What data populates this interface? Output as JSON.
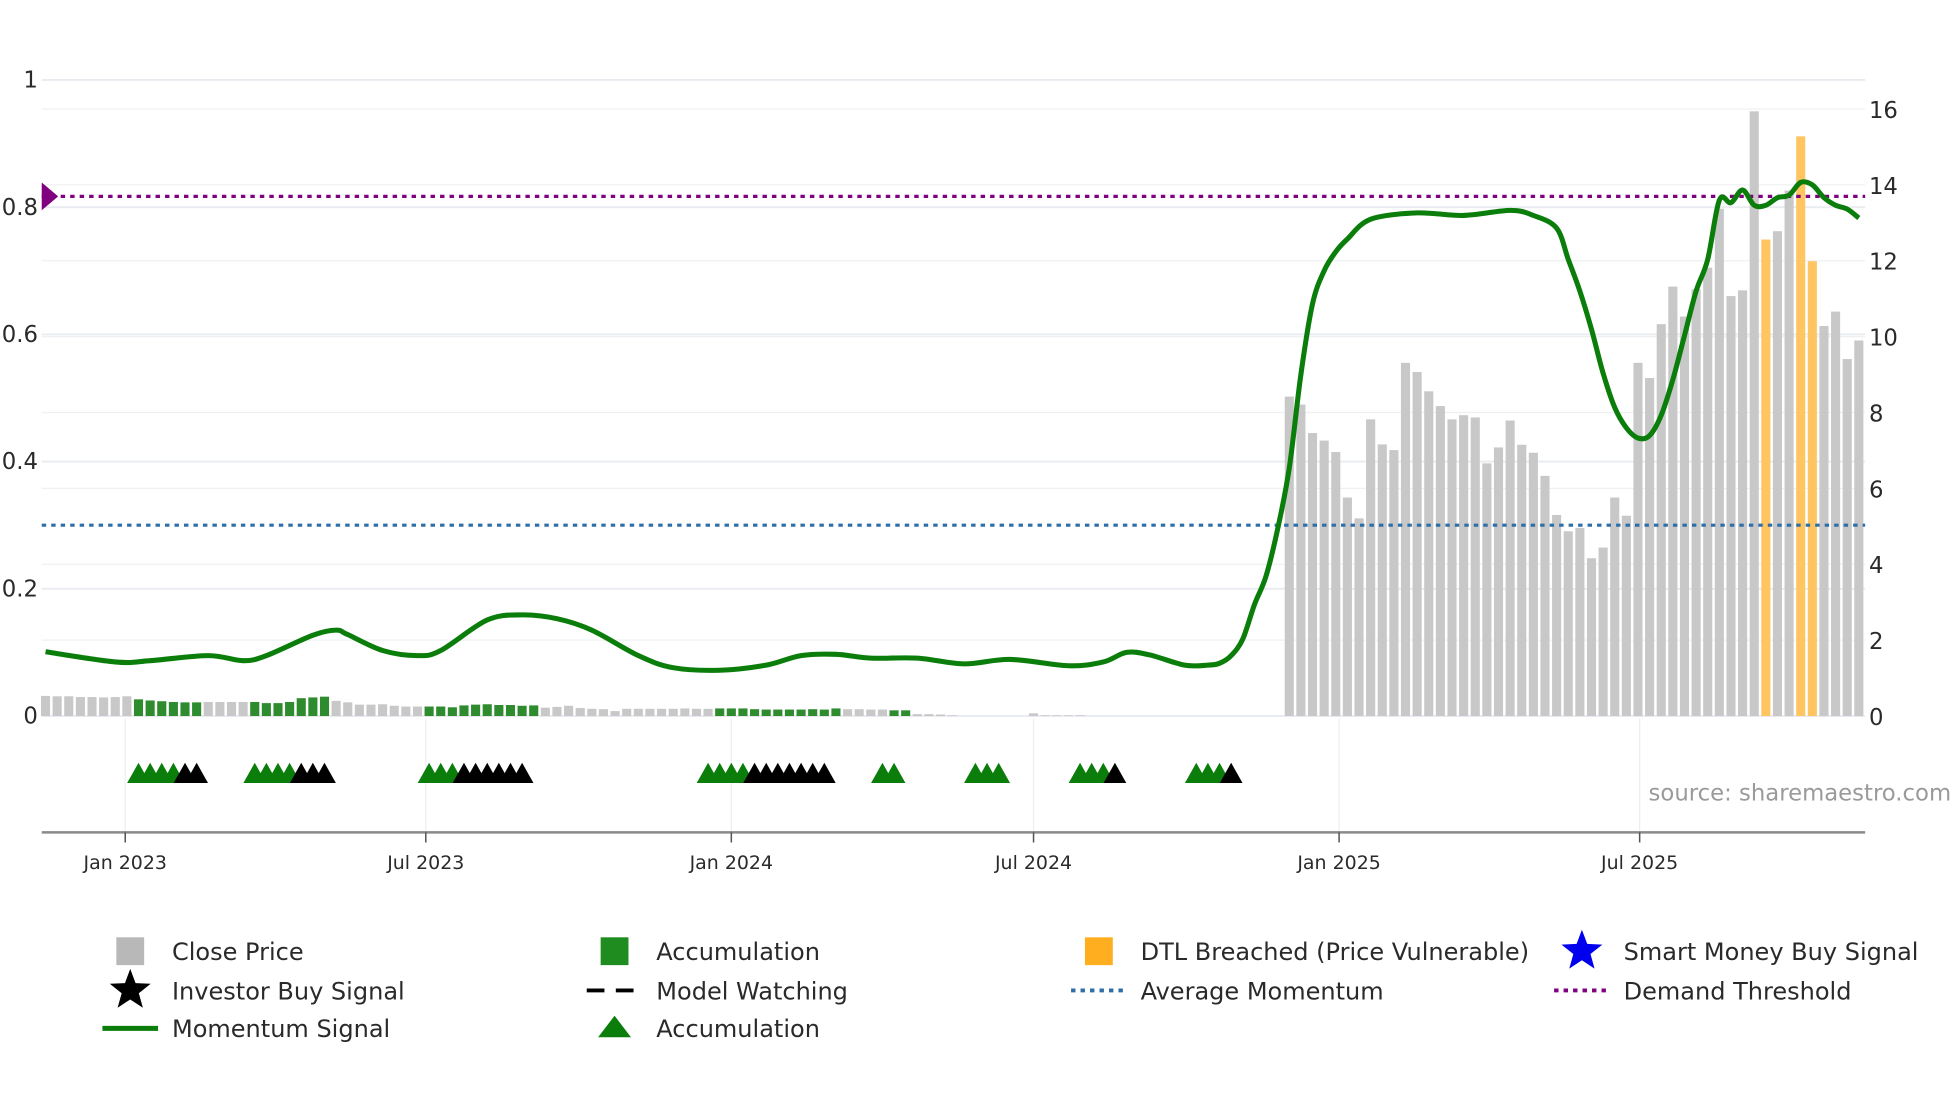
{
  "chart_data": {
    "type": "bar+line",
    "source_note": "source: sharemaestro.com",
    "left_axis": {
      "range": [
        0,
        1
      ],
      "ticks": [
        "0",
        "0.2",
        "0.4",
        "0.6",
        "0.8",
        "1"
      ]
    },
    "right_axis": {
      "range": [
        0,
        16
      ],
      "ticks": [
        "0",
        "2",
        "4",
        "6",
        "8",
        "10",
        "12",
        "14",
        "16"
      ]
    },
    "x_axis": {
      "range": [
        "2022-11-14",
        "2025-11-10"
      ],
      "ticks": [
        {
          "date": "2023-01-01",
          "label": "Jan 2023"
        },
        {
          "date": "2023-07-01",
          "label": "Jul 2023"
        },
        {
          "date": "2024-01-01",
          "label": "Jan 2024"
        },
        {
          "date": "2024-07-01",
          "label": "Jul 2024"
        },
        {
          "date": "2025-01-01",
          "label": "Jan 2025"
        },
        {
          "date": "2025-07-01",
          "label": "Jul 2025"
        }
      ]
    },
    "weeks": [
      "2022-11-14",
      "2022-11-21",
      "2022-11-28",
      "2022-12-05",
      "2022-12-12",
      "2022-12-19",
      "2022-12-26",
      "2023-01-02",
      "2023-01-09",
      "2023-01-16",
      "2023-01-23",
      "2023-01-30",
      "2023-02-06",
      "2023-02-13",
      "2023-02-20",
      "2023-02-27",
      "2023-03-06",
      "2023-03-13",
      "2023-03-20",
      "2023-03-27",
      "2023-04-03",
      "2023-04-10",
      "2023-04-17",
      "2023-04-24",
      "2023-05-01",
      "2023-05-08",
      "2023-05-15",
      "2023-05-22",
      "2023-05-29",
      "2023-06-05",
      "2023-06-12",
      "2023-06-19",
      "2023-06-26",
      "2023-07-03",
      "2023-07-10",
      "2023-07-17",
      "2023-07-24",
      "2023-07-31",
      "2023-08-07",
      "2023-08-14",
      "2023-08-21",
      "2023-08-28",
      "2023-09-04",
      "2023-09-11",
      "2023-09-18",
      "2023-09-25",
      "2023-10-02",
      "2023-10-09",
      "2023-10-16",
      "2023-10-23",
      "2023-10-30",
      "2023-11-06",
      "2023-11-13",
      "2023-11-20",
      "2023-11-27",
      "2023-12-04",
      "2023-12-11",
      "2023-12-18",
      "2023-12-25",
      "2024-01-01",
      "2024-01-08",
      "2024-01-15",
      "2024-01-22",
      "2024-01-29",
      "2024-02-05",
      "2024-02-12",
      "2024-02-19",
      "2024-02-26",
      "2024-03-04",
      "2024-03-11",
      "2024-03-18",
      "2024-03-25",
      "2024-04-01",
      "2024-04-08",
      "2024-04-15",
      "2024-04-22",
      "2024-04-29",
      "2024-05-06",
      "2024-05-13",
      "2024-05-20",
      "2024-05-27",
      "2024-06-03",
      "2024-06-10",
      "2024-06-17",
      "2024-06-24",
      "2024-07-01",
      "2024-07-08",
      "2024-07-15",
      "2024-07-22",
      "2024-07-29",
      "2024-08-05",
      "2024-08-12",
      "2024-08-19",
      "2024-08-26",
      "2024-09-02",
      "2024-09-09",
      "2024-09-16",
      "2024-09-23",
      "2024-09-30",
      "2024-10-07",
      "2024-10-14",
      "2024-10-21",
      "2024-10-28",
      "2024-11-04",
      "2024-11-11",
      "2024-11-18",
      "2024-11-25",
      "2024-12-02",
      "2024-12-09",
      "2024-12-16",
      "2024-12-23",
      "2024-12-30",
      "2025-01-06",
      "2025-01-13",
      "2025-01-20",
      "2025-01-27",
      "2025-02-03",
      "2025-02-10",
      "2025-02-17",
      "2025-02-24",
      "2025-03-03",
      "2025-03-10",
      "2025-03-17",
      "2025-03-24",
      "2025-03-31",
      "2025-04-07",
      "2025-04-14",
      "2025-04-21",
      "2025-04-28",
      "2025-05-05",
      "2025-05-12",
      "2025-05-19",
      "2025-05-26",
      "2025-06-02",
      "2025-06-09",
      "2025-06-16",
      "2025-06-23",
      "2025-06-30",
      "2025-07-07",
      "2025-07-14",
      "2025-07-21",
      "2025-07-28",
      "2025-08-04",
      "2025-08-11",
      "2025-08-18",
      "2025-08-25",
      "2025-09-01",
      "2025-09-08",
      "2025-09-15",
      "2025-09-22",
      "2025-09-29",
      "2025-10-06",
      "2025-10-13",
      "2025-10-20",
      "2025-10-27",
      "2025-11-03",
      "2025-11-10"
    ],
    "close_price": [
      0.53,
      0.52,
      0.52,
      0.5,
      0.5,
      0.49,
      0.5,
      0.52,
      0.44,
      0.41,
      0.39,
      0.37,
      0.36,
      0.36,
      0.37,
      0.37,
      0.37,
      0.37,
      0.37,
      0.34,
      0.34,
      0.37,
      0.47,
      0.49,
      0.51,
      0.4,
      0.36,
      0.3,
      0.3,
      0.31,
      0.27,
      0.25,
      0.25,
      0.25,
      0.25,
      0.23,
      0.28,
      0.3,
      0.31,
      0.29,
      0.29,
      0.27,
      0.28,
      0.22,
      0.24,
      0.27,
      0.21,
      0.19,
      0.18,
      0.13,
      0.19,
      0.19,
      0.19,
      0.19,
      0.19,
      0.2,
      0.19,
      0.19,
      0.2,
      0.2,
      0.2,
      0.18,
      0.17,
      0.17,
      0.17,
      0.17,
      0.18,
      0.17,
      0.2,
      0.18,
      0.18,
      0.17,
      0.17,
      0.15,
      0.15,
      0.05,
      0.05,
      0.04,
      0.02,
      0,
      0,
      0,
      0,
      0,
      0,
      0.07,
      0.02,
      0.02,
      0.02,
      0.02,
      0,
      0,
      0,
      0,
      0,
      0,
      0,
      0,
      0,
      0,
      0,
      0,
      0,
      0,
      0,
      0,
      0,
      8.42,
      8.21,
      7.46,
      7.26,
      6.96,
      5.76,
      5.21,
      7.82,
      7.16,
      7.01,
      9.31,
      9.07,
      8.56,
      8.17,
      7.82,
      7.93,
      7.87,
      6.66,
      7.08,
      7.79,
      7.15,
      6.94,
      6.33,
      5.3,
      4.87,
      4.96,
      4.16,
      4.44,
      5.76,
      5.28,
      9.31,
      8.91,
      10.33,
      11.32,
      10.53,
      11.25,
      11.82,
      13.37,
      11.07,
      11.22,
      15.94,
      12.56,
      12.78,
      13.85,
      15.28,
      11.99,
      10.28,
      10.66,
      9.41,
      9.9
    ],
    "accumulation_bar_ranges": [
      [
        "2023-01-09",
        "2023-02-13"
      ],
      [
        "2023-03-20",
        "2023-05-01"
      ],
      [
        "2023-07-03",
        "2023-09-04"
      ],
      [
        "2023-12-25",
        "2024-03-04"
      ],
      [
        "2024-04-08",
        "2024-04-15"
      ]
    ],
    "dtl_breached_weeks": [
      "2025-09-15",
      "2025-10-06",
      "2025-10-13"
    ],
    "momentum_signal": [
      [
        "2022-11-14",
        0.101
      ],
      [
        "2022-12-26",
        0.085
      ],
      [
        "2023-01-16",
        0.087
      ],
      [
        "2023-02-20",
        0.095
      ],
      [
        "2023-03-13",
        0.087
      ],
      [
        "2023-03-27",
        0.095
      ],
      [
        "2023-04-24",
        0.127
      ],
      [
        "2023-05-08",
        0.135
      ],
      [
        "2023-05-15",
        0.128
      ],
      [
        "2023-06-05",
        0.103
      ],
      [
        "2023-06-26",
        0.095
      ],
      [
        "2023-07-10",
        0.103
      ],
      [
        "2023-08-07",
        0.151
      ],
      [
        "2023-08-28",
        0.159
      ],
      [
        "2023-09-18",
        0.153
      ],
      [
        "2023-10-09",
        0.135
      ],
      [
        "2023-11-06",
        0.095
      ],
      [
        "2023-11-27",
        0.076
      ],
      [
        "2023-12-25",
        0.072
      ],
      [
        "2024-01-22",
        0.08
      ],
      [
        "2024-02-12",
        0.095
      ],
      [
        "2024-03-04",
        0.097
      ],
      [
        "2024-03-25",
        0.091
      ],
      [
        "2024-04-22",
        0.091
      ],
      [
        "2024-05-20",
        0.082
      ],
      [
        "2024-06-17",
        0.089
      ],
      [
        "2024-07-22",
        0.079
      ],
      [
        "2024-08-12",
        0.085
      ],
      [
        "2024-08-26",
        0.1
      ],
      [
        "2024-09-09",
        0.096
      ],
      [
        "2024-09-30",
        0.08
      ],
      [
        "2024-10-14",
        0.08
      ],
      [
        "2024-10-21",
        0.083
      ],
      [
        "2024-10-28",
        0.095
      ],
      [
        "2024-11-04",
        0.121
      ],
      [
        "2024-11-11",
        0.175
      ],
      [
        "2024-11-18",
        0.22
      ],
      [
        "2024-11-25",
        0.294
      ],
      [
        "2024-12-02",
        0.39
      ],
      [
        "2024-12-09",
        0.537
      ],
      [
        "2024-12-16",
        0.648
      ],
      [
        "2024-12-23",
        0.7
      ],
      [
        "2024-12-30",
        0.73
      ],
      [
        "2025-01-06",
        0.75
      ],
      [
        "2025-01-20",
        0.781
      ],
      [
        "2025-02-17",
        0.791
      ],
      [
        "2025-03-17",
        0.787
      ],
      [
        "2025-04-14",
        0.795
      ],
      [
        "2025-04-28",
        0.787
      ],
      [
        "2025-05-12",
        0.767
      ],
      [
        "2025-05-19",
        0.718
      ],
      [
        "2025-05-26",
        0.668
      ],
      [
        "2025-06-02",
        0.608
      ],
      [
        "2025-06-09",
        0.539
      ],
      [
        "2025-06-16",
        0.485
      ],
      [
        "2025-06-23",
        0.453
      ],
      [
        "2025-06-30",
        0.437
      ],
      [
        "2025-07-07",
        0.441
      ],
      [
        "2025-07-14",
        0.473
      ],
      [
        "2025-07-21",
        0.529
      ],
      [
        "2025-07-28",
        0.598
      ],
      [
        "2025-08-04",
        0.668
      ],
      [
        "2025-08-11",
        0.718
      ],
      [
        "2025-08-18",
        0.811
      ],
      [
        "2025-08-25",
        0.807
      ],
      [
        "2025-09-01",
        0.827
      ],
      [
        "2025-09-08",
        0.803
      ],
      [
        "2025-09-15",
        0.803
      ],
      [
        "2025-09-22",
        0.815
      ],
      [
        "2025-09-29",
        0.819
      ],
      [
        "2025-10-06",
        0.839
      ],
      [
        "2025-10-13",
        0.835
      ],
      [
        "2025-10-20",
        0.815
      ],
      [
        "2025-10-27",
        0.803
      ],
      [
        "2025-11-03",
        0.797
      ],
      [
        "2025-11-10",
        0.783
      ]
    ],
    "average_momentum": 0.3,
    "demand_threshold": 0.817,
    "accumulation_marker_ranges": [
      [
        "2023-01-09",
        "2023-01-30"
      ],
      [
        "2023-03-20",
        "2023-04-10"
      ],
      [
        "2023-07-03",
        "2023-07-17"
      ],
      [
        "2023-12-18",
        "2024-01-08"
      ],
      [
        "2024-04-01",
        "2024-04-08"
      ],
      [
        "2024-05-27",
        "2024-06-10"
      ],
      [
        "2024-07-29",
        "2024-08-12"
      ],
      [
        "2024-10-07",
        "2024-10-21"
      ]
    ],
    "black_marker_ranges": [
      [
        "2023-02-06",
        "2023-02-13"
      ],
      [
        "2023-04-17",
        "2023-05-01"
      ],
      [
        "2023-07-24",
        "2023-08-28"
      ],
      [
        "2024-01-15",
        "2024-02-26"
      ],
      [
        "2024-08-19",
        "2024-08-19"
      ],
      [
        "2024-10-28",
        "2024-10-28"
      ]
    ],
    "colors": {
      "close_price": "#c8c8c8",
      "accumulation": "#2e8b2e",
      "dtl_breached": "#ffc560",
      "momentum": "#0a7d0a",
      "average_momentum": "#2e6fa8",
      "demand_threshold": "#800080",
      "smart_money": "#0000ee",
      "marker_black": "#000000"
    },
    "legend": {
      "placement": "bottom",
      "items": [
        {
          "label": "Close Price",
          "symbol": "square",
          "color": "#b8b8b8"
        },
        {
          "label": "Accumulation",
          "symbol": "square",
          "color": "#1f8c1f"
        },
        {
          "label": "DTL Breached (Price Vulnerable)",
          "symbol": "square",
          "color": "#ffae20"
        },
        {
          "label": "Smart Money Buy Signal",
          "symbol": "star",
          "color": "#0000ee"
        },
        {
          "label": "Investor Buy Signal",
          "symbol": "star",
          "color": "#000000"
        },
        {
          "label": "Model Watching",
          "symbol": "dash",
          "color": "#000000"
        },
        {
          "label": "Average Momentum",
          "symbol": "dot",
          "color": "#2e6fa8"
        },
        {
          "label": "Demand Threshold",
          "symbol": "dot",
          "color": "#800080"
        },
        {
          "label": "Momentum Signal",
          "symbol": "line",
          "color": "#0a7d0a"
        },
        {
          "label": "Accumulation",
          "symbol": "triangle",
          "color": "#0a7d0a"
        }
      ]
    }
  }
}
